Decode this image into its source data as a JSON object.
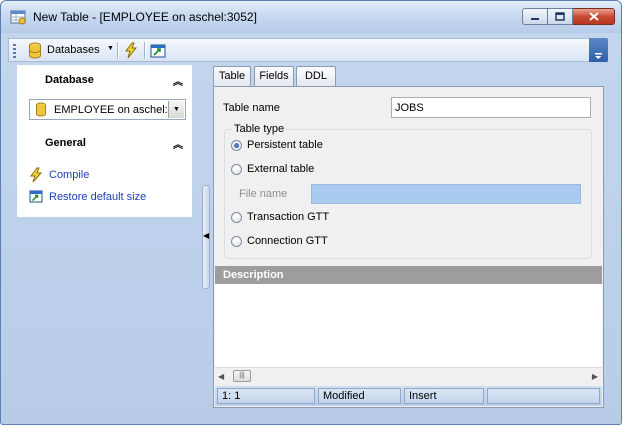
{
  "window": {
    "title": "New Table - [EMPLOYEE on aschel:3052]",
    "icon": "table-window-icon",
    "controls": [
      "minimize-icon",
      "maximize-icon",
      "close-icon"
    ]
  },
  "toolbar": {
    "databases_label": "Databases",
    "items": [
      "database-icon",
      "compile-icon",
      "restore-size-icon"
    ]
  },
  "left_panel": {
    "database_section": {
      "title": "Database",
      "selected_db": "EMPLOYEE on aschel:"
    },
    "general_section": {
      "title": "General",
      "links": [
        {
          "label": "Compile",
          "icon": "lightning-icon"
        },
        {
          "label": "Restore default size",
          "icon": "restore-size-icon"
        }
      ]
    }
  },
  "tabs": [
    {
      "label": "Table",
      "active": true
    },
    {
      "label": "Fields",
      "active": false
    },
    {
      "label": "DDL",
      "active": false
    }
  ],
  "form": {
    "table_name_label": "Table name",
    "table_name_value": "JOBS",
    "table_type_label": "Table type",
    "options": [
      {
        "label": "Persistent table",
        "checked": true
      },
      {
        "label": "External table",
        "checked": false
      },
      {
        "label": "Transaction GTT",
        "checked": false
      },
      {
        "label": "Connection GTT",
        "checked": false
      }
    ],
    "file_name_label": "File name",
    "file_name_value": ""
  },
  "description": {
    "title": "Description",
    "text": ""
  },
  "statusbar": {
    "position": "1:     1",
    "modified": "Modified",
    "mode": "Insert",
    "extra": ""
  },
  "colors": {
    "accent": "#1c3fb7",
    "titlebar": "#c9daf1",
    "description_header": "#9d9d9d",
    "file_field_fill": "#aacbf0"
  }
}
